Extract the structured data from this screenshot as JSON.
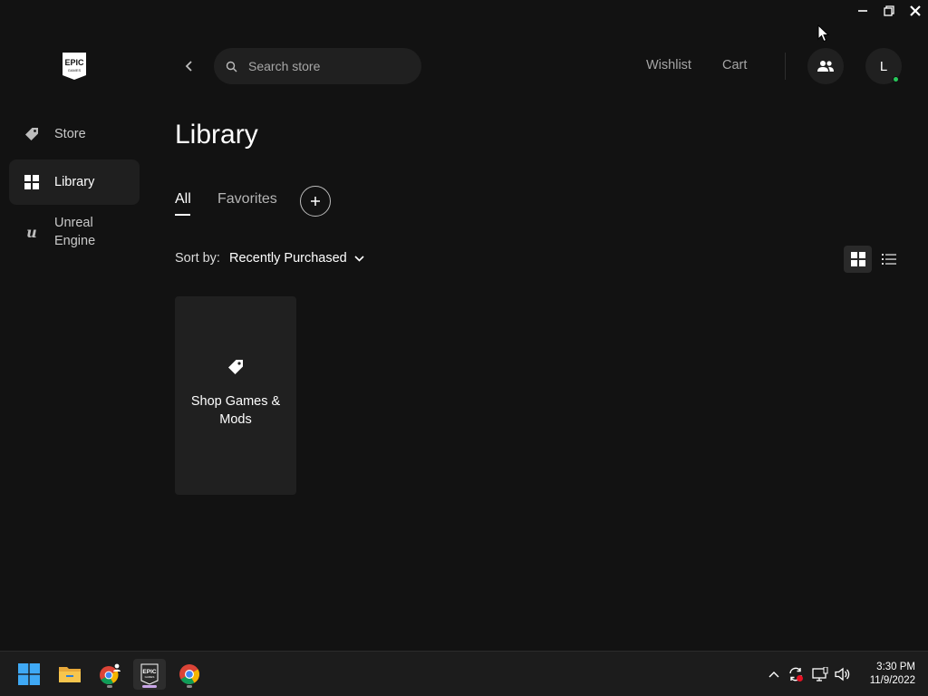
{
  "window": {
    "minimize_icon": "minimize-icon",
    "restore_icon": "restore-icon",
    "close_icon": "close-icon"
  },
  "logo": {
    "line1": "EPIC",
    "line2": "GAMES"
  },
  "sidebar": {
    "items": [
      {
        "label": "Store",
        "icon": "tag-icon",
        "active": false
      },
      {
        "label": "Library",
        "icon": "grid-icon",
        "active": true
      },
      {
        "label": "Unreal\nEngine",
        "icon": "unreal-icon",
        "active": false
      }
    ]
  },
  "topbar": {
    "search_placeholder": "Search store",
    "wishlist": "Wishlist",
    "cart": "Cart",
    "avatar_initial": "L",
    "status_color": "#27c95b"
  },
  "main": {
    "title": "Library",
    "tabs": [
      {
        "label": "All",
        "active": true
      },
      {
        "label": "Favorites",
        "active": false
      }
    ],
    "sort_label": "Sort by:",
    "sort_value": "Recently Purchased",
    "view_mode": "grid",
    "cards": [
      {
        "label": "Shop Games & Mods",
        "icon": "tag-icon"
      }
    ]
  },
  "taskbar": {
    "apps": [
      {
        "name": "start",
        "icon": "windows-icon"
      },
      {
        "name": "file-explorer",
        "icon": "folder-icon"
      },
      {
        "name": "chrome-profile",
        "icon": "chrome-icon"
      },
      {
        "name": "epic-games",
        "icon": "epic-icon",
        "active": true
      },
      {
        "name": "chrome",
        "icon": "chrome-icon"
      }
    ],
    "time": "3:30 PM",
    "date": "11/9/2022"
  },
  "colors": {
    "background": "#121212",
    "surface": "#202020",
    "active_nav": "#1f1f1f",
    "text_muted": "#a5a5a5"
  }
}
